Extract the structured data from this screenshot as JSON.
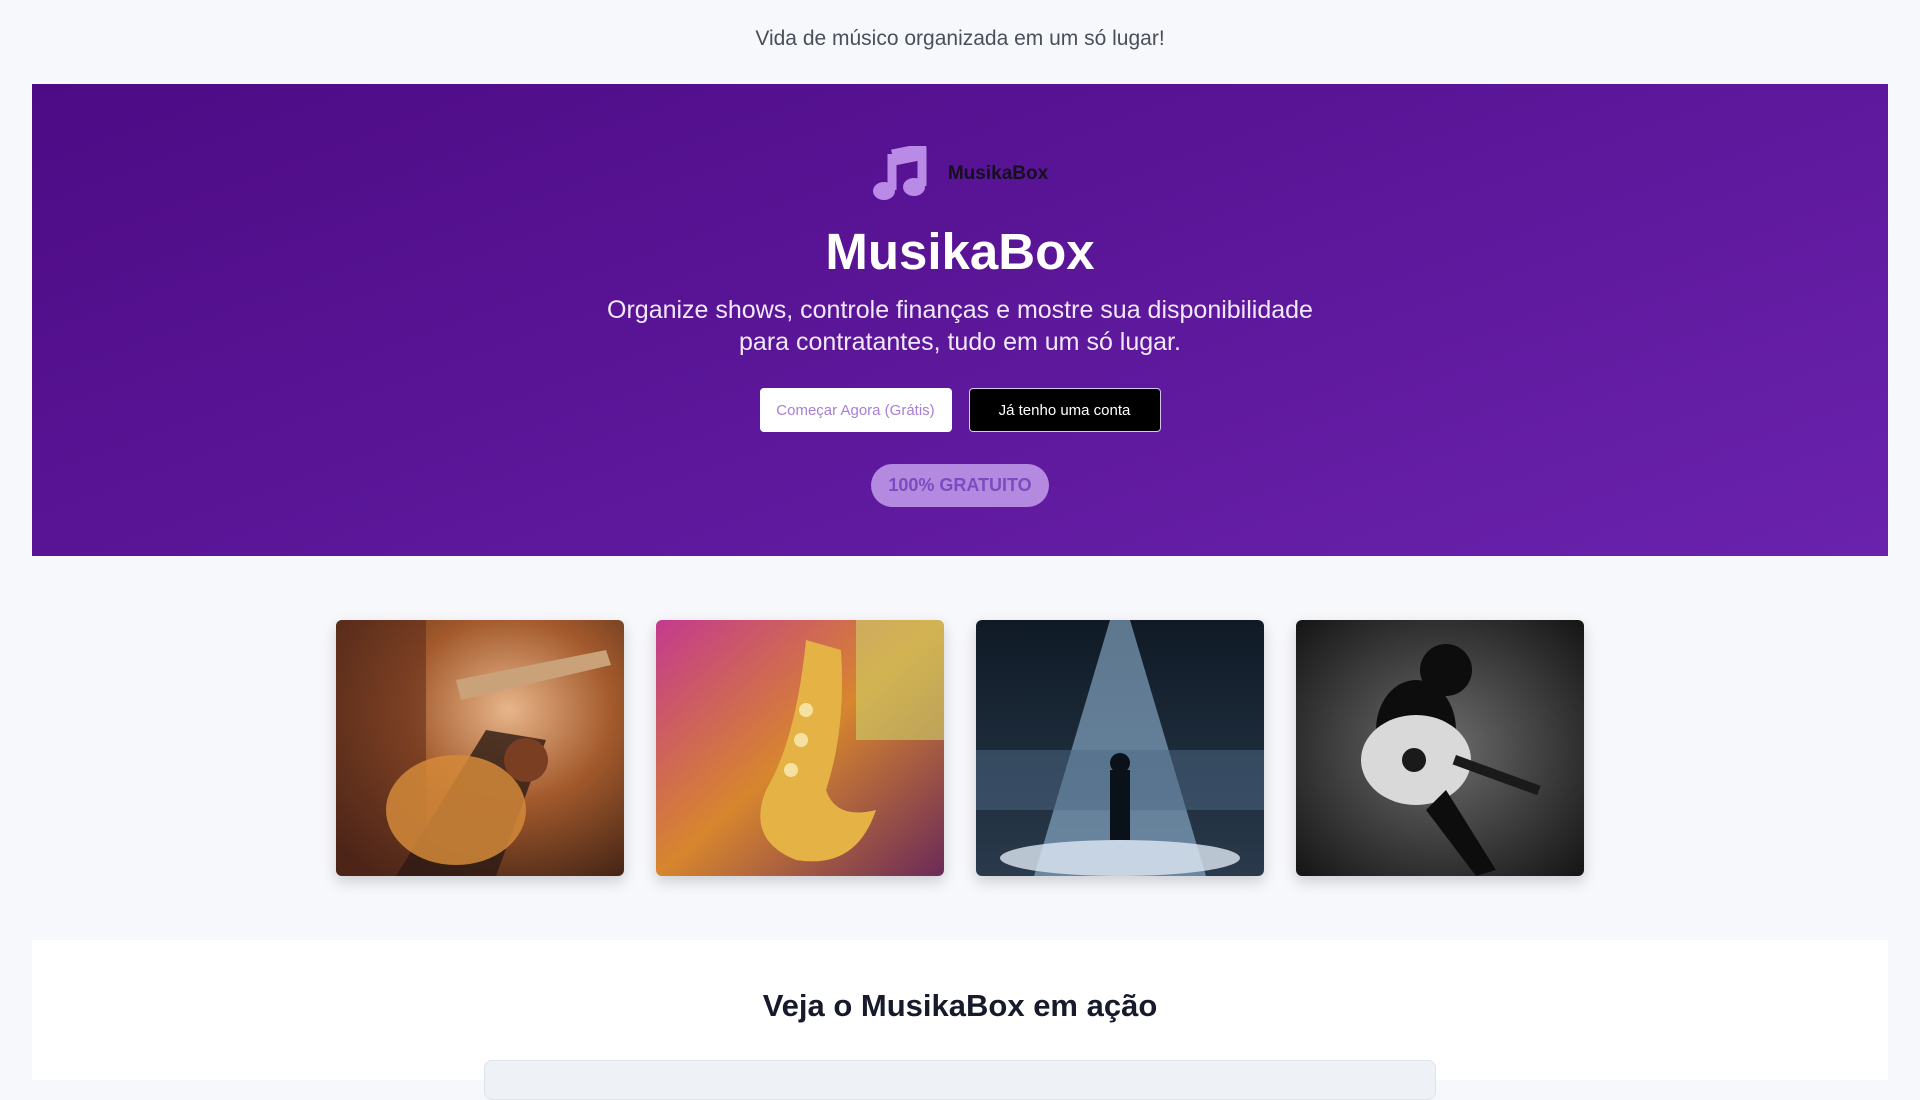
{
  "tagline": "Vida de músico organizada em um só lugar!",
  "hero": {
    "brand_small": "MusikaBox",
    "title": "MusikaBox",
    "subtitle": "Organize shows, controle finanças e mostre sua disponibilidade para contratantes, tudo em um só lugar.",
    "primary_button": "Começar Agora (Grátis)",
    "secondary_button": "Já tenho uma conta",
    "badge": "100% GRATUITO",
    "logo_icon": "music-note-icon"
  },
  "gallery": [
    {
      "subject": "guitarist-closeup"
    },
    {
      "subject": "saxophone"
    },
    {
      "subject": "stage-spotlight-crowd"
    },
    {
      "subject": "acoustic-guitar-silhouette"
    }
  ],
  "demo": {
    "title": "Veja o MusikaBox em ação"
  },
  "colors": {
    "hero_start": "#4d0b85",
    "hero_end": "#6a22ad",
    "logo": "#b98ae6",
    "badge_bg": "#b48ae0"
  }
}
